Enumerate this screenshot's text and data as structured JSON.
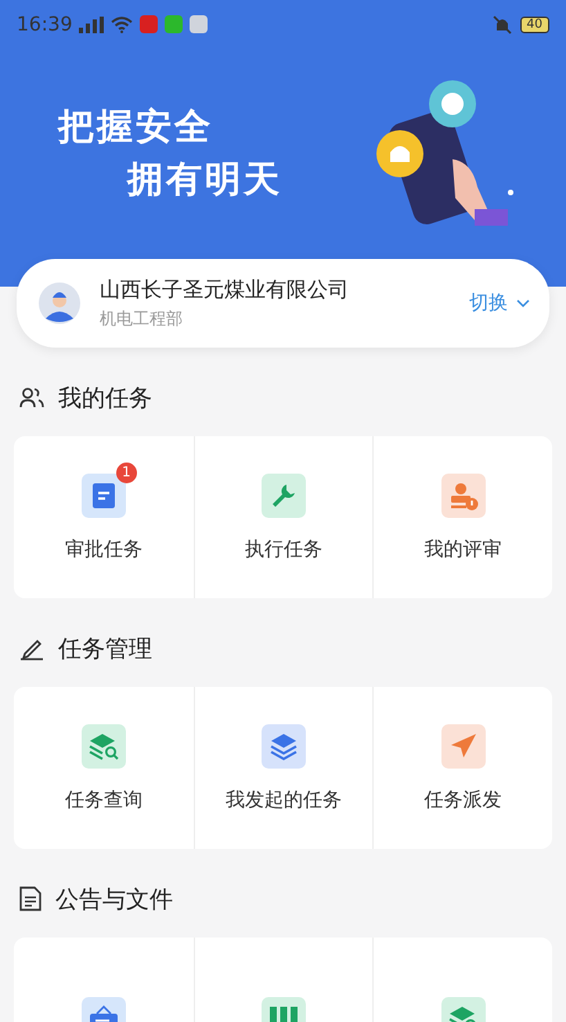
{
  "status_bar": {
    "time": "16:39",
    "battery": "40"
  },
  "banner": {
    "lines": [
      "把握安全",
      "拥有明天"
    ]
  },
  "org_card": {
    "company": "山西长子圣元煤业有限公司",
    "department": "机电工程部",
    "switch_label": "切换"
  },
  "sections": [
    {
      "title": "我的任务",
      "kind": "people",
      "items": [
        {
          "label": "审批任务",
          "kind": "doc",
          "badge": "1"
        },
        {
          "label": "执行任务",
          "kind": "wrench"
        },
        {
          "label": "我的评审",
          "kind": "stamp"
        }
      ]
    },
    {
      "title": "任务管理",
      "kind": "pen",
      "items": [
        {
          "label": "任务查询",
          "kind": "layers-search"
        },
        {
          "label": "我发起的任务",
          "kind": "layers"
        },
        {
          "label": "任务派发",
          "kind": "plane"
        }
      ]
    },
    {
      "title": "公告与文件",
      "kind": "file",
      "items": [
        {
          "kind": "board"
        },
        {
          "kind": "binders"
        },
        {
          "kind": "layers-search"
        }
      ]
    }
  ]
}
